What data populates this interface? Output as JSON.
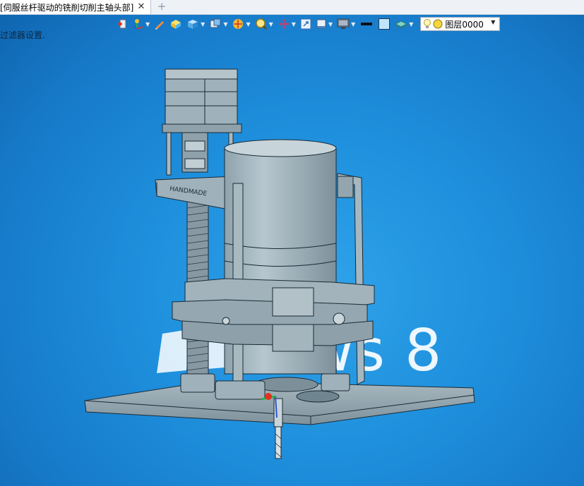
{
  "tab": {
    "title": "[伺服丝杆驱动的铣削切削主轴头部]",
    "close_glyph": "✕",
    "new_tab_glyph": "+"
  },
  "toolbar": {
    "layer_label": "图层0000",
    "line_color": "#111111",
    "fill_color": "#bfe6ff"
  },
  "status": {
    "text": "过滤器设置."
  },
  "wallpaper": {
    "text": "dows 8",
    "brand_color": "#1e8fdc"
  },
  "model": {
    "engraving": "HANDMADE"
  }
}
